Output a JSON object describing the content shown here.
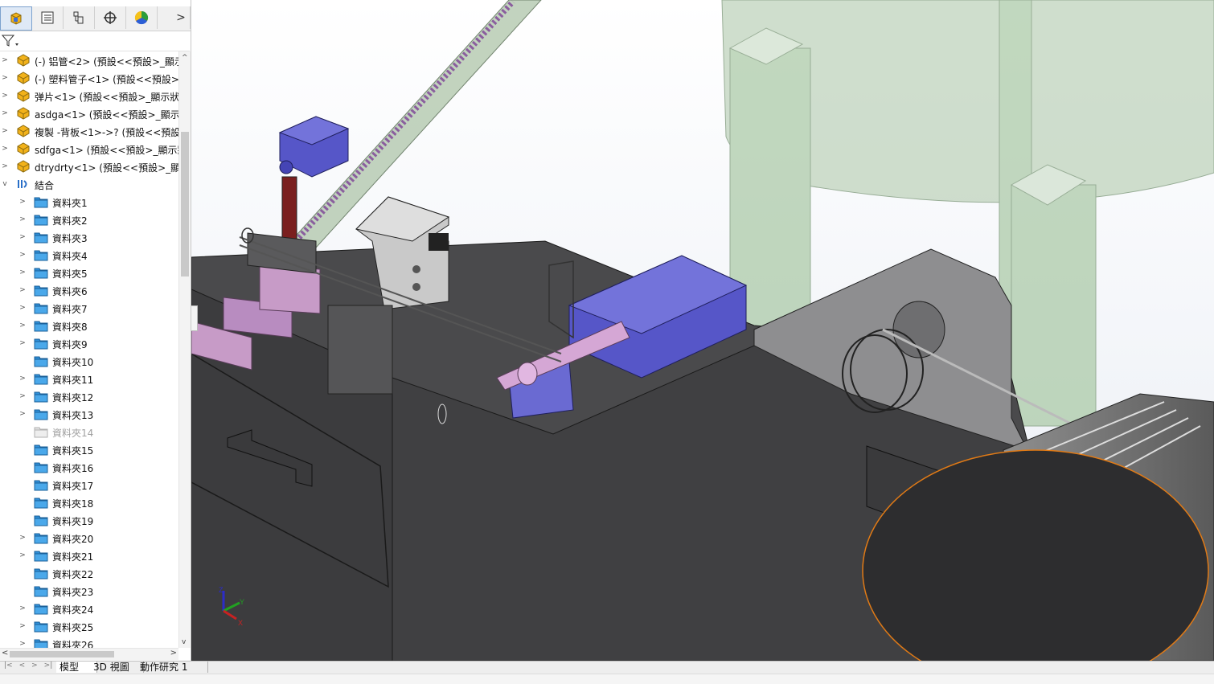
{
  "panel": {
    "tabs": [
      {
        "name": "featuremanager-tab",
        "icon": "assembly-tree-icon"
      },
      {
        "name": "propertymanager-tab",
        "icon": "property-list-icon"
      },
      {
        "name": "configurationmanager-tab",
        "icon": "configuration-icon"
      },
      {
        "name": "dimxpert-tab",
        "icon": "crosshair-icon"
      },
      {
        "name": "display-manager-tab",
        "icon": "appearance-icon"
      }
    ],
    "more_label": ">",
    "filter_icon": "filter-icon",
    "tree": [
      {
        "label": "(-) 铝管<2> (預設<<預設>_顯示",
        "icon": "part-icon",
        "expandable": true,
        "level": 0
      },
      {
        "label": "(-) 塑料管子<1> (預設<<預設>_",
        "icon": "part-icon",
        "expandable": true,
        "level": 0
      },
      {
        "label": "弹片<1> (預設<<預設>_顯示狀態",
        "icon": "part-icon",
        "expandable": true,
        "level": 0
      },
      {
        "label": "asdga<1> (預設<<預設>_顯示狀",
        "icon": "part-icon",
        "expandable": true,
        "level": 0
      },
      {
        "label": "複製 -背板<1>->? (預設<<預設",
        "icon": "part-icon",
        "expandable": true,
        "level": 0
      },
      {
        "label": "sdfga<1> (預設<<預設>_顯示狀",
        "icon": "part-icon",
        "expandable": true,
        "level": 0
      },
      {
        "label": "dtrydrty<1> (預設<<預設>_顯示",
        "icon": "part-icon",
        "expandable": true,
        "level": 0
      },
      {
        "label": "結合",
        "icon": "mates-icon",
        "expandable": true,
        "expanded": true,
        "level": 0
      },
      {
        "label": "資料夾1",
        "icon": "folder-icon",
        "expandable": true,
        "level": 1
      },
      {
        "label": "資料夾2",
        "icon": "folder-icon",
        "expandable": true,
        "level": 1
      },
      {
        "label": "資料夾3",
        "icon": "folder-icon",
        "expandable": true,
        "level": 1
      },
      {
        "label": "資料夾4",
        "icon": "folder-icon",
        "expandable": true,
        "level": 1
      },
      {
        "label": "資料夾5",
        "icon": "folder-icon",
        "expandable": true,
        "level": 1
      },
      {
        "label": "資料夾6",
        "icon": "folder-icon",
        "expandable": true,
        "level": 1
      },
      {
        "label": "資料夾7",
        "icon": "folder-icon",
        "expandable": true,
        "level": 1
      },
      {
        "label": "資料夾8",
        "icon": "folder-icon",
        "expandable": true,
        "level": 1
      },
      {
        "label": "資料夾9",
        "icon": "folder-icon",
        "expandable": true,
        "level": 1
      },
      {
        "label": "資料夾10",
        "icon": "folder-icon",
        "expandable": false,
        "level": 1
      },
      {
        "label": "資料夾11",
        "icon": "folder-icon",
        "expandable": true,
        "level": 1
      },
      {
        "label": "資料夾12",
        "icon": "folder-icon",
        "expandable": true,
        "level": 1
      },
      {
        "label": "資料夾13",
        "icon": "folder-icon",
        "expandable": true,
        "level": 1
      },
      {
        "label": "資料夾14",
        "icon": "empty-folder-icon",
        "expandable": false,
        "level": 1,
        "dim": true
      },
      {
        "label": "資料夾15",
        "icon": "folder-icon",
        "expandable": false,
        "level": 1
      },
      {
        "label": "資料夾16",
        "icon": "folder-icon",
        "expandable": false,
        "level": 1
      },
      {
        "label": "資料夾17",
        "icon": "folder-icon",
        "expandable": false,
        "level": 1
      },
      {
        "label": "資料夾18",
        "icon": "folder-icon",
        "expandable": false,
        "level": 1
      },
      {
        "label": "資料夾19",
        "icon": "folder-icon",
        "expandable": false,
        "level": 1
      },
      {
        "label": "資料夾20",
        "icon": "folder-icon",
        "expandable": true,
        "level": 1
      },
      {
        "label": "資料夾21",
        "icon": "folder-icon",
        "expandable": true,
        "level": 1
      },
      {
        "label": "資料夾22",
        "icon": "folder-icon",
        "expandable": false,
        "level": 1
      },
      {
        "label": "資料夾23",
        "icon": "folder-icon",
        "expandable": false,
        "level": 1
      },
      {
        "label": "資料夾24",
        "icon": "folder-icon",
        "expandable": true,
        "level": 1
      },
      {
        "label": "資料夾25",
        "icon": "folder-icon",
        "expandable": true,
        "level": 1
      },
      {
        "label": "資料夾26",
        "icon": "folder-icon",
        "expandable": true,
        "level": 1
      }
    ]
  },
  "viewport": {
    "triad": {
      "x_label": "X",
      "y_label": "Y",
      "z_label": "Z"
    }
  },
  "bottom_tabs": {
    "nav_arrows": [
      "|<",
      "<",
      ">",
      ">|"
    ],
    "items": [
      "模型",
      "3D 視圖",
      "動作研究 1"
    ],
    "active_index": 0
  },
  "colors": {
    "folder_blue": "#2e8fd8",
    "part_yellow": "#f2b21a",
    "body_dark": "#3c3c3e",
    "motor_purple": "#5656c8",
    "transparent_green": "#a8c8a4",
    "pink_part": "#c79bc7",
    "edge_orange": "#e07a16"
  }
}
